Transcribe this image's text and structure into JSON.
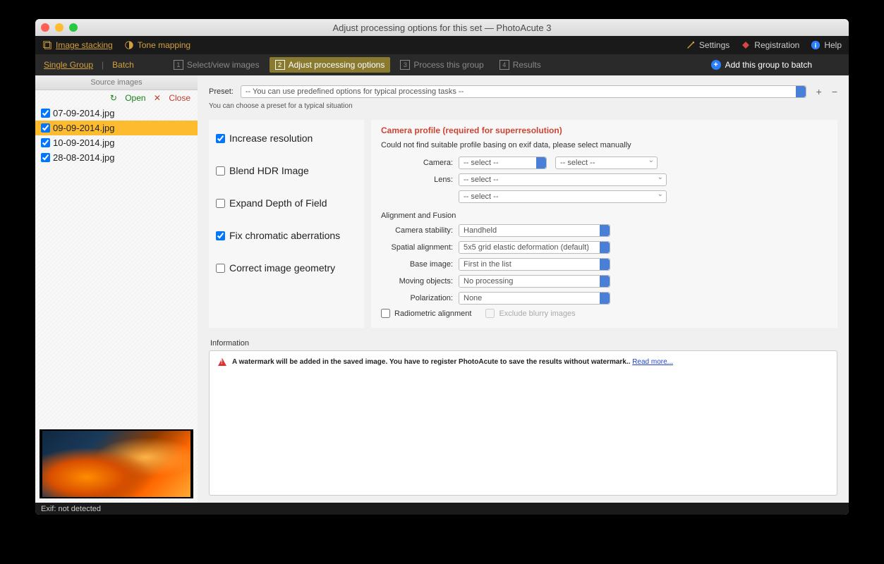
{
  "title": "Adjust processing options for this set — PhotoAcute 3",
  "bar1": {
    "image_stacking": "Image stacking",
    "tone_mapping": "Tone mapping",
    "settings": "Settings",
    "registration": "Registration",
    "help": "Help"
  },
  "bar2": {
    "single_group": "Single Group",
    "batch": "Batch",
    "steps": [
      {
        "n": "1",
        "label": "Select/view images"
      },
      {
        "n": "2",
        "label": "Adjust processing options"
      },
      {
        "n": "3",
        "label": "Process this group"
      },
      {
        "n": "4",
        "label": "Results"
      }
    ],
    "active_step": 1,
    "add_batch": "Add this group to batch"
  },
  "sidebar": {
    "header": "Source images",
    "open": "Open",
    "close": "Close",
    "files": [
      {
        "name": "07-09-2014.jpg",
        "checked": true,
        "selected": false
      },
      {
        "name": "09-09-2014.jpg",
        "checked": true,
        "selected": true
      },
      {
        "name": "10-09-2014.jpg",
        "checked": true,
        "selected": false
      },
      {
        "name": "28-08-2014.jpg",
        "checked": true,
        "selected": false
      }
    ]
  },
  "preset": {
    "label": "Preset:",
    "value": "-- You can use predefined options for typical processing tasks --",
    "hint": "You can choose a preset for a typical situation"
  },
  "options": [
    {
      "label": "Increase resolution",
      "checked": true
    },
    {
      "label": "Blend HDR Image",
      "checked": false
    },
    {
      "label": "Expand Depth of Field",
      "checked": false
    },
    {
      "label": "Fix chromatic aberrations",
      "checked": true
    },
    {
      "label": "Correct image geometry",
      "checked": false
    }
  ],
  "camera": {
    "title": "Camera profile (required for superresolution)",
    "sub": "Could not find suitable profile basing on exif data, please select manually",
    "camera_lbl": "Camera:",
    "lens_lbl": "Lens:",
    "select_ph": "-- select --"
  },
  "alignment": {
    "section": "Alignment and Fusion",
    "rows": [
      {
        "lbl": "Camera stability:",
        "val": "Handheld"
      },
      {
        "lbl": "Spatial alignment:",
        "val": "5x5 grid elastic deformation (default)"
      },
      {
        "lbl": "Base image:",
        "val": "First in the list"
      },
      {
        "lbl": "Moving objects:",
        "val": "No processing"
      },
      {
        "lbl": "Polarization:",
        "val": "None"
      }
    ],
    "radiometric": "Radiometric alignment",
    "exclude": "Exclude blurry images"
  },
  "info": {
    "label": "Information",
    "text": "A watermark will be added in the saved image. You have to register PhotoAcute to save the results without watermark..",
    "link": "Read more..."
  },
  "status": "Exif: not detected"
}
